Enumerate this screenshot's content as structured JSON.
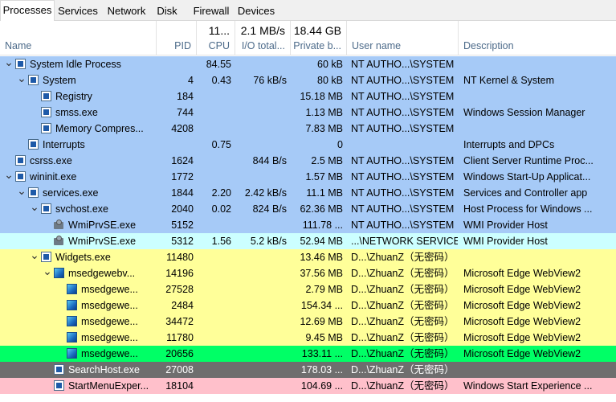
{
  "tabs": [
    {
      "label": "Processes"
    },
    {
      "label": "Services"
    },
    {
      "label": "Network"
    },
    {
      "label": "Disk"
    },
    {
      "label": "Firewall"
    },
    {
      "label": "Devices"
    }
  ],
  "columns": {
    "name": {
      "label": "Name"
    },
    "pid": {
      "label": "PID"
    },
    "cpu": {
      "summary": "11...",
      "label": "CPU"
    },
    "io": {
      "summary": "2.1 MB/s",
      "label": "I/O total..."
    },
    "priv": {
      "summary": "18.44 GB",
      "label": "Private b..."
    },
    "user": {
      "label": "User name"
    },
    "desc": {
      "label": "Description"
    }
  },
  "colors": {
    "blue": "#a6caf7",
    "cyan": "#ccffff",
    "yellow": "#ffff99",
    "green": "#00ff66",
    "gray": "#6e6e6e",
    "pink": "#ffc0cb"
  },
  "rows": [
    {
      "name": "System Idle Process",
      "pid": "",
      "cpu": "84.55",
      "io": "",
      "priv": "60 kB",
      "user": "NT AUTHO...\\SYSTEM",
      "desc": "",
      "icon": "window-icon",
      "indent": 0,
      "exp": "v",
      "color": "blue"
    },
    {
      "name": "System",
      "pid": "4",
      "cpu": "0.43",
      "io": "76 kB/s",
      "priv": "80 kB",
      "user": "NT AUTHO...\\SYSTEM",
      "desc": "NT Kernel & System",
      "icon": "window-icon",
      "indent": 1,
      "exp": "v",
      "color": "blue"
    },
    {
      "name": "Registry",
      "pid": "184",
      "cpu": "",
      "io": "",
      "priv": "15.18 MB",
      "user": "NT AUTHO...\\SYSTEM",
      "desc": "",
      "icon": "window-icon",
      "indent": 2,
      "exp": "",
      "color": "blue"
    },
    {
      "name": "smss.exe",
      "pid": "744",
      "cpu": "",
      "io": "",
      "priv": "1.13 MB",
      "user": "NT AUTHO...\\SYSTEM",
      "desc": "Windows Session Manager",
      "icon": "window-icon",
      "indent": 2,
      "exp": "",
      "color": "blue"
    },
    {
      "name": "Memory Compres...",
      "pid": "4208",
      "cpu": "",
      "io": "",
      "priv": "7.83 MB",
      "user": "NT AUTHO...\\SYSTEM",
      "desc": "",
      "icon": "window-icon",
      "indent": 2,
      "exp": "",
      "color": "blue"
    },
    {
      "name": "Interrupts",
      "pid": "",
      "cpu": "0.75",
      "io": "",
      "priv": "0",
      "user": "",
      "desc": "Interrupts and DPCs",
      "icon": "window-icon",
      "indent": 1,
      "exp": "",
      "color": "blue"
    },
    {
      "name": "csrss.exe",
      "pid": "1624",
      "cpu": "",
      "io": "844 B/s",
      "priv": "2.5 MB",
      "user": "NT AUTHO...\\SYSTEM",
      "desc": "Client Server Runtime Proc...",
      "icon": "window-icon",
      "indent": 0,
      "exp": "",
      "color": "blue"
    },
    {
      "name": "wininit.exe",
      "pid": "1772",
      "cpu": "",
      "io": "",
      "priv": "1.57 MB",
      "user": "NT AUTHO...\\SYSTEM",
      "desc": "Windows Start-Up Applicat...",
      "icon": "window-icon",
      "indent": 0,
      "exp": "v",
      "color": "blue"
    },
    {
      "name": "services.exe",
      "pid": "1844",
      "cpu": "2.20",
      "io": "2.42 kB/s",
      "priv": "11.1 MB",
      "user": "NT AUTHO...\\SYSTEM",
      "desc": "Services and Controller app",
      "icon": "window-icon",
      "indent": 1,
      "exp": "v",
      "color": "blue"
    },
    {
      "name": "svchost.exe",
      "pid": "2040",
      "cpu": "0.02",
      "io": "824 B/s",
      "priv": "62.36 MB",
      "user": "NT AUTHO...\\SYSTEM",
      "desc": "Host Process for Windows ...",
      "icon": "window-icon",
      "indent": 2,
      "exp": "v",
      "color": "blue"
    },
    {
      "name": "WmiPrvSE.exe",
      "pid": "5152",
      "cpu": "",
      "io": "",
      "priv": "111.78 ...",
      "user": "NT AUTHO...\\SYSTEM",
      "desc": "WMI Provider Host",
      "icon": "gear-icon",
      "indent": 3,
      "exp": "",
      "color": "blue"
    },
    {
      "name": "WmiPrvSE.exe",
      "pid": "5312",
      "cpu": "1.56",
      "io": "5.2 kB/s",
      "priv": "52.94 MB",
      "user": "...\\NETWORK SERVICE",
      "desc": "WMI Provider Host",
      "icon": "gear-icon",
      "indent": 3,
      "exp": "",
      "color": "cyan"
    },
    {
      "name": "Widgets.exe",
      "pid": "11480",
      "cpu": "",
      "io": "",
      "priv": "13.46 MB",
      "user": "D...\\ZhuanZ（无密码）",
      "desc": "",
      "icon": "window-icon",
      "indent": 2,
      "exp": "v",
      "color": "yellow"
    },
    {
      "name": "msedgewebv...",
      "pid": "14196",
      "cpu": "",
      "io": "",
      "priv": "37.56 MB",
      "user": "D...\\ZhuanZ（无密码）",
      "desc": "Microsoft Edge WebView2",
      "icon": "edge-icon",
      "indent": 3,
      "exp": "v",
      "color": "yellow"
    },
    {
      "name": "msedgewe...",
      "pid": "27528",
      "cpu": "",
      "io": "",
      "priv": "2.79 MB",
      "user": "D...\\ZhuanZ（无密码）",
      "desc": "Microsoft Edge WebView2",
      "icon": "edge-icon",
      "indent": 4,
      "exp": "",
      "color": "yellow"
    },
    {
      "name": "msedgewe...",
      "pid": "2484",
      "cpu": "",
      "io": "",
      "priv": "154.34 ...",
      "user": "D...\\ZhuanZ（无密码）",
      "desc": "Microsoft Edge WebView2",
      "icon": "edge-icon",
      "indent": 4,
      "exp": "",
      "color": "yellow"
    },
    {
      "name": "msedgewe...",
      "pid": "34472",
      "cpu": "",
      "io": "",
      "priv": "12.69 MB",
      "user": "D...\\ZhuanZ（无密码）",
      "desc": "Microsoft Edge WebView2",
      "icon": "edge-icon",
      "indent": 4,
      "exp": "",
      "color": "yellow"
    },
    {
      "name": "msedgewe...",
      "pid": "11780",
      "cpu": "",
      "io": "",
      "priv": "9.45 MB",
      "user": "D...\\ZhuanZ（无密码）",
      "desc": "Microsoft Edge WebView2",
      "icon": "edge-icon",
      "indent": 4,
      "exp": "",
      "color": "yellow"
    },
    {
      "name": "msedgewe...",
      "pid": "20656",
      "cpu": "",
      "io": "",
      "priv": "133.11 ...",
      "user": "D...\\ZhuanZ（无密码）",
      "desc": "Microsoft Edge WebView2",
      "icon": "edge-icon",
      "indent": 4,
      "exp": "",
      "color": "green"
    },
    {
      "name": "SearchHost.exe",
      "pid": "27008",
      "cpu": "",
      "io": "",
      "priv": "178.03 ...",
      "user": "D...\\ZhuanZ（无密码）",
      "desc": "",
      "icon": "window-icon",
      "indent": 3,
      "exp": "",
      "color": "gray"
    },
    {
      "name": "StartMenuExper...",
      "pid": "18104",
      "cpu": "",
      "io": "",
      "priv": "104.69 ...",
      "user": "D...\\ZhuanZ（无密码）",
      "desc": "Windows Start Experience ...",
      "icon": "window-icon",
      "indent": 3,
      "exp": "",
      "color": "pink"
    }
  ]
}
